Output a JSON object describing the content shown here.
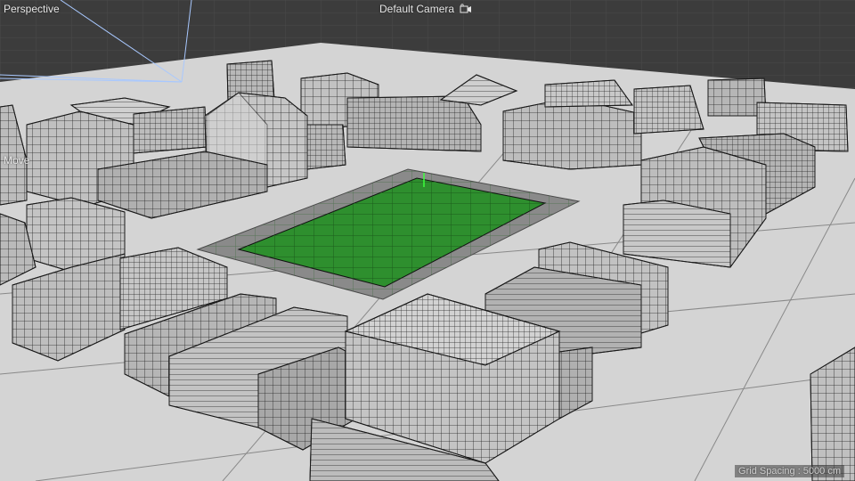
{
  "viewport": {
    "projection_label": "Perspective",
    "camera_label": "Default Camera",
    "active_tool_label": "Move",
    "grid_spacing_label": "Grid Spacing : 5000 cm",
    "icons": {
      "camera": "camera-icon"
    }
  },
  "colors": {
    "background": "#3c3c3c",
    "ground": "#d4d4d4",
    "grid_line": "#555555",
    "plaza_border": "#8a8a8a",
    "selected_plane": "#2e8f2e",
    "building_light": "#c9c9c9",
    "building_mid": "#a9a9a9",
    "building_dark": "#8c8c8c",
    "wire": "#1a1a1a"
  }
}
